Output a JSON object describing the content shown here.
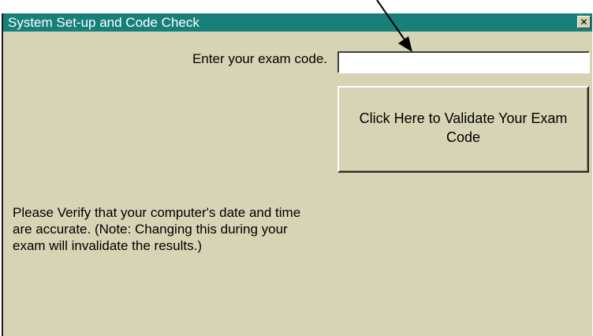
{
  "window": {
    "title": "System Set-up and Code Check",
    "close_glyph": "✕",
    "close_icon": "close-icon"
  },
  "form": {
    "code_label": "Enter your exam code.",
    "code_value": "",
    "code_placeholder": "",
    "validate_button_label": "Click Here to Validate Your Exam Code"
  },
  "note": {
    "text": "Please Verify that your computer's date and time are accurate.  (Note:  Changing this during your exam will invalidate the results.)"
  },
  "annotation": {
    "arrow_icon": "arrow-pointer-icon",
    "color": "#000000"
  },
  "colors": {
    "title_bar": "#17807a",
    "window_background": "#d6d4b4",
    "title_text": "#ffffff"
  }
}
